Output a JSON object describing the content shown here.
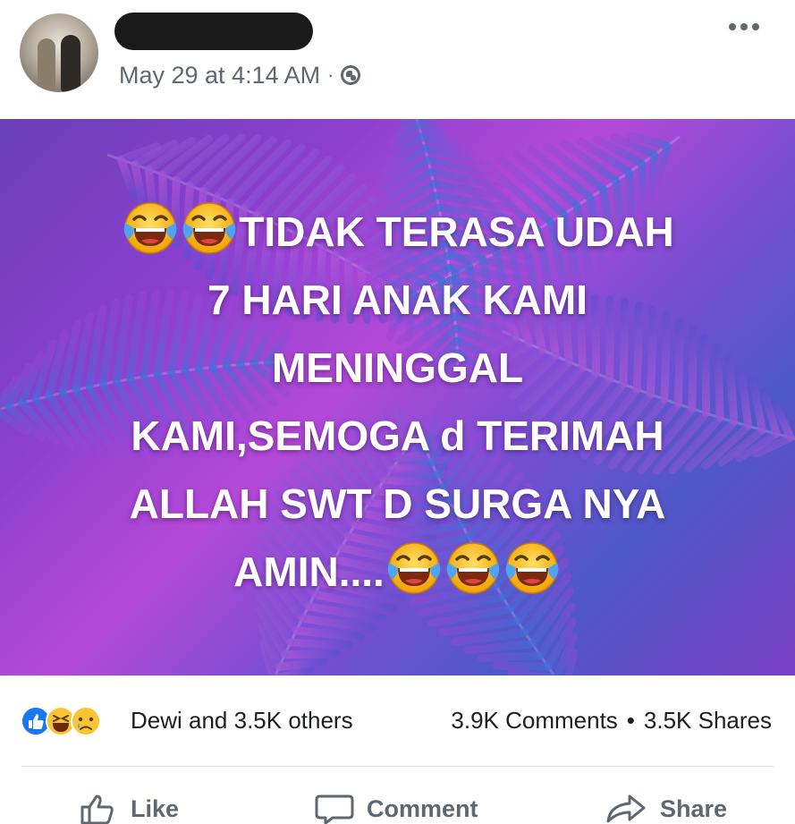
{
  "post": {
    "timestamp": "May 29 at 4:14 AM",
    "meta_separator": "·",
    "audience_icon": "globe-icon",
    "more_icon": "more-options-icon",
    "caption_lines": [
      "TIDAK TERASA UDAH",
      "7 HARI ANAK KAMI",
      "MENINGGAL",
      "KAMI,SEMOGA d TERIMAH",
      "ALLAH SWT D SURGA NYA",
      "AMIN...."
    ],
    "caption_emoji": "face-with-tears-of-joy"
  },
  "reactions": {
    "icons": [
      "like-reaction-icon",
      "haha-reaction-icon",
      "sad-reaction-icon"
    ],
    "names_text": "Dewi and 3.5K others",
    "comments_text": "3.9K Comments",
    "separator": "•",
    "shares_text": "3.5K Shares"
  },
  "actions": {
    "like_label": "Like",
    "comment_label": "Comment",
    "share_label": "Share"
  },
  "colors": {
    "meta_text": "#606770",
    "brand_blue": "#1877f2",
    "image_purple": "#8a3fcf",
    "image_blue": "#4e58c8"
  }
}
